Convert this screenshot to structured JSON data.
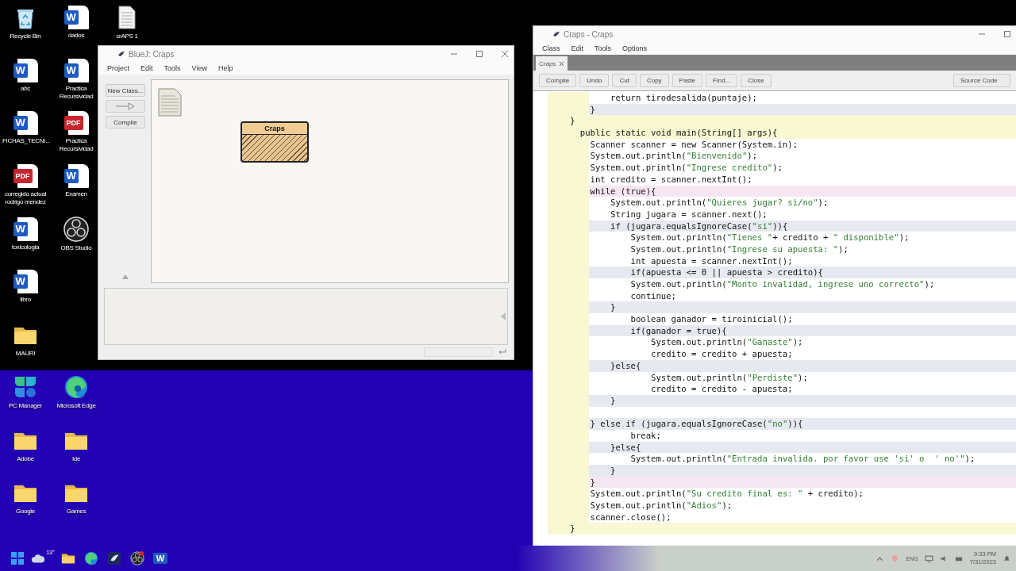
{
  "desktop_icons_top": [
    [
      {
        "kind": "recycle",
        "label": "Recycle Bin"
      },
      {
        "kind": "word",
        "badge": "W",
        "label": "abc"
      },
      {
        "kind": "word",
        "badge": "W",
        "label": "FICHAS_TECNI..."
      },
      {
        "kind": "pdf",
        "badge": "PDF",
        "label": "corregido actual rodrigo mendez"
      },
      {
        "kind": "word",
        "badge": "W",
        "label": "toxicologia"
      },
      {
        "kind": "word",
        "badge": "W",
        "label": "libro"
      },
      {
        "kind": "folder",
        "label": "MAURI"
      }
    ],
    [
      {
        "kind": "word",
        "badge": "W",
        "label": "dados"
      },
      {
        "kind": "word",
        "badge": "W",
        "label": "Practica Recursividad"
      },
      {
        "kind": "pdf",
        "badge": "PDF",
        "label": "Practica Recursividad"
      },
      {
        "kind": "word",
        "badge": "W",
        "label": "Examen"
      },
      {
        "kind": "obs",
        "label": "OBS Studio"
      }
    ],
    [
      {
        "kind": "text",
        "label": "crAPS 1"
      }
    ]
  ],
  "desktop_icons_bottom": [
    [
      {
        "kind": "pcmanager",
        "label": "PC Manager"
      },
      {
        "kind": "folder",
        "label": "Adobe"
      },
      {
        "kind": "folder",
        "label": "Google"
      }
    ],
    [
      {
        "kind": "edge",
        "label": "Microsoft Edge"
      },
      {
        "kind": "folder",
        "label": "Ide"
      },
      {
        "kind": "folder",
        "label": "Games"
      }
    ]
  ],
  "bluej_window": {
    "title": "BlueJ: Craps",
    "menu": [
      "Project",
      "Edit",
      "Tools",
      "View",
      "Help"
    ],
    "buttons": [
      {
        "kind": "text",
        "label": "New Class..."
      },
      {
        "kind": "arrow"
      },
      {
        "kind": "text",
        "label": "Compile"
      }
    ],
    "classes": [
      {
        "name": "Craps"
      }
    ]
  },
  "editor_window": {
    "title": "Craps - Craps",
    "menu": [
      "Class",
      "Edit",
      "Tools",
      "Options"
    ],
    "tabs": [
      {
        "label": "Craps",
        "selected": true
      }
    ],
    "toolbar": [
      "Compile",
      "Undo",
      "Cut",
      "Copy",
      "Paste",
      "Find...",
      "Close"
    ],
    "view_selector": "Source Code",
    "code_lines": [
      {
        "kind": "plain",
        "text": "        return tirodesalida(puntaje);"
      },
      {
        "kind": "branch",
        "text": "    }"
      },
      {
        "kind": "header",
        "text": "}"
      },
      {
        "kind": "header",
        "text": "  public static void main(String[] args){"
      },
      {
        "kind": "plain",
        "text": "    Scanner scanner = new Scanner(System.in);"
      },
      {
        "kind": "plain",
        "text": "    System.out.println(\"Bienvenido\");"
      },
      {
        "kind": "plain",
        "text": "    System.out.println(\"Ingrese credito\");"
      },
      {
        "kind": "plain",
        "text": "    int credito = scanner.nextInt();"
      },
      {
        "kind": "loop",
        "text": "    while (true){"
      },
      {
        "kind": "plain",
        "text": "        System.out.println(\"Quieres jugar? si/no\");"
      },
      {
        "kind": "plain",
        "text": "        String jugara = scanner.next();"
      },
      {
        "kind": "branch",
        "text": "        if (jugara.equalsIgnoreCase(\"si\")){"
      },
      {
        "kind": "plain",
        "text": "            System.out.println(\"Tienes \"+ credito + \" disponible\");"
      },
      {
        "kind": "plain",
        "text": "            System.out.println(\"Ingrese su apuesta: \");"
      },
      {
        "kind": "plain",
        "text": "            int apuesta = scanner.nextInt();"
      },
      {
        "kind": "branch",
        "text": "            if(apuesta <= 0 || apuesta > credito){"
      },
      {
        "kind": "plain",
        "text": "            System.out.println(\"Monto invalidad, ingrese uno correcto\");"
      },
      {
        "kind": "plain",
        "text": "            continue;"
      },
      {
        "kind": "branch",
        "text": "        }"
      },
      {
        "kind": "plain",
        "text": "            boolean ganador = tiroinicial();"
      },
      {
        "kind": "branch",
        "text": "            if(ganador = true){"
      },
      {
        "kind": "plain",
        "text": "                System.out.println(\"Ganaste\");"
      },
      {
        "kind": "plain",
        "text": "                credito = credito + apuesta;"
      },
      {
        "kind": "branch",
        "text": "        }else{"
      },
      {
        "kind": "plain",
        "text": "                System.out.println(\"Perdiste\");"
      },
      {
        "kind": "plain",
        "text": "                credito = credito - apuesta;"
      },
      {
        "kind": "branch",
        "text": "        }"
      },
      {
        "kind": "plain"
      },
      {
        "kind": "branch",
        "text": "    } else if (jugara.equalsIgnoreCase(\"no\")){"
      },
      {
        "kind": "plain",
        "text": "            break;"
      },
      {
        "kind": "branch",
        "text": "        }else{"
      },
      {
        "kind": "plain",
        "text": "            System.out.println(\"Entrada invalida. por favor use 'si' o  ' no'\");"
      },
      {
        "kind": "branch",
        "text": "        }"
      },
      {
        "kind": "loop",
        "text": "    }"
      },
      {
        "kind": "plain",
        "text": "    System.out.println(\"Su credito final es: \" + credito);"
      },
      {
        "kind": "plain",
        "text": "    System.out.println(\"Adios\");"
      },
      {
        "kind": "plain",
        "text": "    scanner.close();"
      },
      {
        "kind": "header",
        "text": "}"
      }
    ]
  },
  "taskbar": {
    "pinned": [
      {
        "kind": "start"
      },
      {
        "kind": "weather",
        "label": "13°"
      },
      {
        "kind": "explorer"
      },
      {
        "kind": "edge"
      },
      {
        "kind": "bluej"
      },
      {
        "kind": "obs"
      },
      {
        "kind": "word",
        "badge": "W"
      }
    ],
    "language": "ENG",
    "time": "9:33 PM",
    "date": "7/31/2023"
  }
}
